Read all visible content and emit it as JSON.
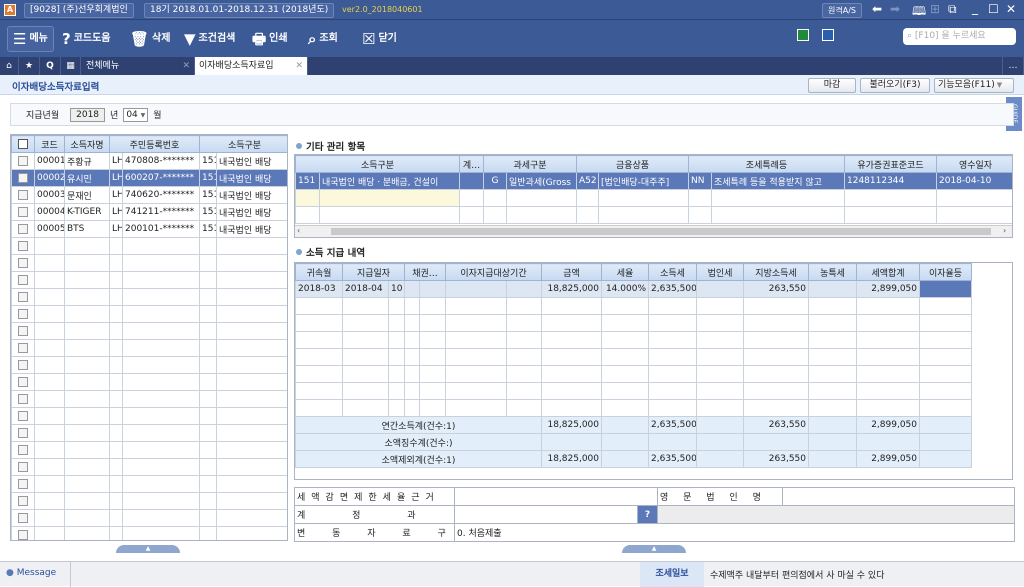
{
  "titlebar": {
    "company": "[9028] (주)선우회계법인",
    "period": "18기 2018.01.01-2018.12.31 (2018년도)",
    "version": "ver2.0_2018040601",
    "remote_as": "원격A/S"
  },
  "toolbar": {
    "menu": "메뉴",
    "code_help": "코드도움",
    "delete": "삭제",
    "filter": "조건검색",
    "print": "인쇄",
    "search": "조회",
    "close": "닫기",
    "search_placeholder": "[F10] 을 누르세요"
  },
  "tabs": {
    "all_menu": "전체메뉴",
    "active": "이자배당소득자료입"
  },
  "page": {
    "title": "이자배당소득자료입력",
    "btn_close_month": "마감",
    "btn_load": "불러오기(F3)",
    "btn_functions": "기능모음(F11)",
    "guide": "GUIDE"
  },
  "filter": {
    "label": "지급년월",
    "year": "2018",
    "year_unit": "년",
    "month": "04",
    "month_unit": "월"
  },
  "left_grid": {
    "headers": [
      "코드",
      "소득자명",
      "주민등록번호",
      "소득구분"
    ],
    "rows": [
      {
        "code": "00001",
        "name": "주황규",
        "type": "LH",
        "rrn": "470808-*******",
        "inc_code": "151",
        "inc_name": "내국법인 배당",
        "selected": false
      },
      {
        "code": "00002",
        "name": "유시민",
        "type": "LH",
        "rrn": "600207-*******",
        "inc_code": "151",
        "inc_name": "내국법인 배당",
        "selected": true
      },
      {
        "code": "00003",
        "name": "문재인",
        "type": "LH",
        "rrn": "740620-*******",
        "inc_code": "151",
        "inc_name": "내국법인 배당",
        "selected": false
      },
      {
        "code": "00004",
        "name": "K-TIGER",
        "type": "LH",
        "rrn": "741211-*******",
        "inc_code": "151",
        "inc_name": "내국법인 배당",
        "selected": false
      },
      {
        "code": "00005",
        "name": "BTS",
        "type": "LH",
        "rrn": "200101-*******",
        "inc_code": "151",
        "inc_name": "내국법인 배당",
        "selected": false
      }
    ]
  },
  "other_items": {
    "title": "기타 관리 항목",
    "headers": [
      "소득구분",
      "계…",
      "과세구분",
      "금융상품",
      "조세특례등",
      "유가증권표준코드",
      "영수일자"
    ],
    "row": [
      "151",
      "내국법인 배당ㆍ분배금, 건설이",
      "",
      "G",
      "일반과세(Gross",
      "A52",
      "[법인배당-대주주]",
      "NN",
      "조세특례 등을 적용받지 않고",
      "1248112344",
      "2018-04-10"
    ]
  },
  "payments": {
    "title": "소득 지급 내역",
    "headers": [
      "귀속월",
      "지급일자",
      "채권…",
      "이자지급대상기간",
      "금액",
      "세율",
      "소득세",
      "법인세",
      "지방소득세",
      "농특세",
      "세액합계",
      "이자율등"
    ],
    "row": [
      "2018-03",
      "2018-04",
      "10",
      "",
      "",
      "",
      "",
      "18,825,000",
      "14.000%",
      "2,635,500",
      "",
      "263,550",
      "",
      "2,899,050",
      ""
    ],
    "summary": [
      {
        "label": "연간소득계(건수:1)",
        "amount": "18,825,000",
        "income_tax": "2,635,500",
        "local_tax": "263,550",
        "total_tax": "2,899,050"
      },
      {
        "label": "소액징수계(건수:)",
        "amount": "",
        "income_tax": "",
        "local_tax": "",
        "total_tax": ""
      },
      {
        "label": "소액제외계(건수:1)",
        "amount": "18,825,000",
        "income_tax": "2,635,500",
        "local_tax": "263,550",
        "total_tax": "2,899,050"
      }
    ]
  },
  "form": {
    "tax_reduction_label": "세액감면제한세율근거",
    "english_name_label": "영 문 법 인 명",
    "account_label": "계 정 과 목",
    "change_type_label": "변 동 자 료 구 분",
    "change_type_value": "0. 처음제출",
    "help": "?"
  },
  "status": {
    "message": "Message",
    "tip_label": "조세일보",
    "tip_text": "수제맥주 내달부터 편의점에서 사 마실 수 있다"
  }
}
